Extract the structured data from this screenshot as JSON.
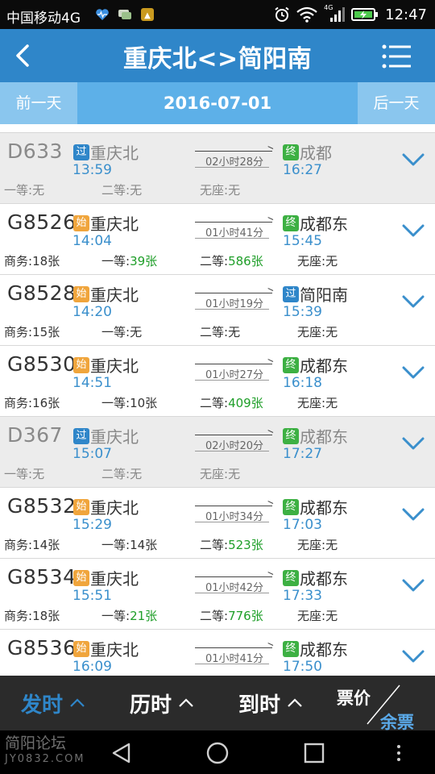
{
  "status_bar": {
    "carrier": "中国移动4G",
    "network": "4G",
    "time": "12:47",
    "icons": [
      "heart-rate-icon",
      "chat-icon",
      "app-notify-icon",
      "alarm-icon",
      "wifi-icon",
      "signal-icon",
      "battery-charging-icon"
    ]
  },
  "header": {
    "title": "重庆北<>简阳南",
    "back_icon": "chevron-left-icon",
    "menu_icon": "list-menu-icon"
  },
  "date_bar": {
    "prev_label": "前一天",
    "date": "2016-07-01",
    "next_label": "后一天"
  },
  "trains": [
    {
      "no": "D633",
      "gray": true,
      "from_badge": "过",
      "from_badge_type": "guo",
      "from": "重庆北",
      "dep": "13:59",
      "duration": "02小时28分",
      "to_badge": "终",
      "to_badge_type": "zhong",
      "to": "成都",
      "arr": "16:27",
      "seats": [
        {
          "label": "一等:",
          "value": "无",
          "green": false
        },
        {
          "label": "二等:",
          "value": "无",
          "green": false
        },
        {
          "label": "无座:",
          "value": "无",
          "green": false
        }
      ]
    },
    {
      "no": "G8526",
      "gray": false,
      "from_badge": "始",
      "from_badge_type": "shi",
      "from": "重庆北",
      "dep": "14:04",
      "duration": "01小时41分",
      "to_badge": "终",
      "to_badge_type": "zhong",
      "to": "成都东",
      "arr": "15:45",
      "seats": [
        {
          "label": "商务:",
          "value": "18张",
          "green": false
        },
        {
          "label": "一等:",
          "value": "39张",
          "green": true
        },
        {
          "label": "二等:",
          "value": "586张",
          "green": true
        },
        {
          "label": "无座:",
          "value": "无",
          "green": false
        }
      ]
    },
    {
      "no": "G8528",
      "gray": false,
      "from_badge": "始",
      "from_badge_type": "shi",
      "from": "重庆北",
      "dep": "14:20",
      "duration": "01小时19分",
      "to_badge": "过",
      "to_badge_type": "guo",
      "to": "简阳南",
      "arr": "15:39",
      "seats": [
        {
          "label": "商务:",
          "value": "15张",
          "green": false
        },
        {
          "label": "一等:",
          "value": "无",
          "green": false
        },
        {
          "label": "二等:",
          "value": "无",
          "green": false
        },
        {
          "label": "无座:",
          "value": "无",
          "green": false
        }
      ]
    },
    {
      "no": "G8530",
      "gray": false,
      "from_badge": "始",
      "from_badge_type": "shi",
      "from": "重庆北",
      "dep": "14:51",
      "duration": "01小时27分",
      "to_badge": "终",
      "to_badge_type": "zhong",
      "to": "成都东",
      "arr": "16:18",
      "seats": [
        {
          "label": "商务:",
          "value": "16张",
          "green": false
        },
        {
          "label": "一等:",
          "value": "10张",
          "green": false
        },
        {
          "label": "二等:",
          "value": "409张",
          "green": true
        },
        {
          "label": "无座:",
          "value": "无",
          "green": false
        }
      ]
    },
    {
      "no": "D367",
      "gray": true,
      "from_badge": "过",
      "from_badge_type": "guo",
      "from": "重庆北",
      "dep": "15:07",
      "duration": "02小时20分",
      "to_badge": "终",
      "to_badge_type": "zhong",
      "to": "成都东",
      "arr": "17:27",
      "seats": [
        {
          "label": "一等:",
          "value": "无",
          "green": false
        },
        {
          "label": "二等:",
          "value": "无",
          "green": false
        },
        {
          "label": "无座:",
          "value": "无",
          "green": false
        }
      ]
    },
    {
      "no": "G8532",
      "gray": false,
      "from_badge": "始",
      "from_badge_type": "shi",
      "from": "重庆北",
      "dep": "15:29",
      "duration": "01小时34分",
      "to_badge": "终",
      "to_badge_type": "zhong",
      "to": "成都东",
      "arr": "17:03",
      "seats": [
        {
          "label": "商务:",
          "value": "14张",
          "green": false
        },
        {
          "label": "一等:",
          "value": "14张",
          "green": false
        },
        {
          "label": "二等:",
          "value": "523张",
          "green": true
        },
        {
          "label": "无座:",
          "value": "无",
          "green": false
        }
      ]
    },
    {
      "no": "G8534",
      "gray": false,
      "from_badge": "始",
      "from_badge_type": "shi",
      "from": "重庆北",
      "dep": "15:51",
      "duration": "01小时42分",
      "to_badge": "终",
      "to_badge_type": "zhong",
      "to": "成都东",
      "arr": "17:33",
      "seats": [
        {
          "label": "商务:",
          "value": "18张",
          "green": false
        },
        {
          "label": "一等:",
          "value": "21张",
          "green": true
        },
        {
          "label": "二等:",
          "value": "776张",
          "green": true
        },
        {
          "label": "无座:",
          "value": "无",
          "green": false
        }
      ]
    },
    {
      "no": "G8536",
      "gray": false,
      "from_badge": "始",
      "from_badge_type": "shi",
      "from": "重庆北",
      "dep": "16:09",
      "duration": "01小时41分",
      "to_badge": "终",
      "to_badge_type": "zhong",
      "to": "成都东",
      "arr": "17:50",
      "seats": []
    }
  ],
  "sort_bar": {
    "dep_label": "发时",
    "dur_label": "历时",
    "arr_label": "到时",
    "price_label": "票价",
    "remain_label": "余票",
    "active": "dep"
  },
  "nav_bar": {
    "watermark_name": "简阳论坛",
    "watermark_url": "JY0832.COM",
    "buttons": [
      "back-triangle-icon",
      "home-circle-icon",
      "recents-square-icon",
      "more-dots-icon"
    ]
  },
  "colors": {
    "primary": "#2f86c9",
    "date_bar": "#5db0e8",
    "time_blue": "#3a8fcc",
    "green_available": "#1e9e28",
    "badge_orange": "#f0a53c",
    "badge_green": "#3db043"
  }
}
